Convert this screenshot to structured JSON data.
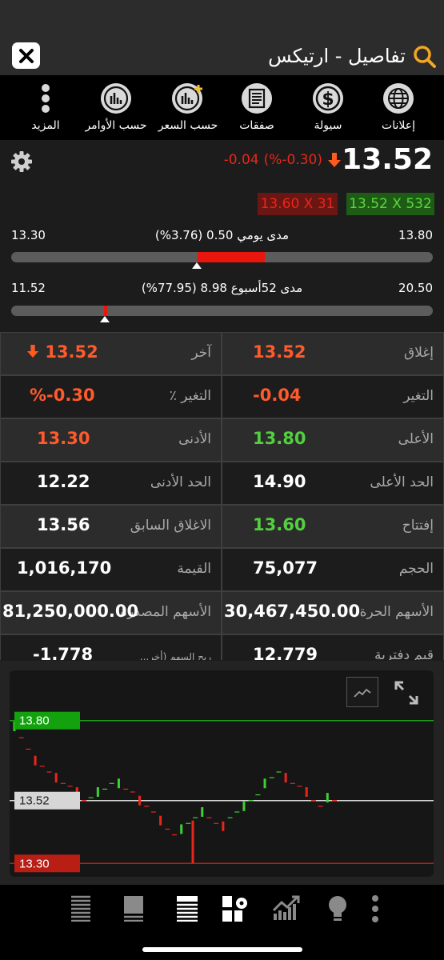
{
  "header": {
    "title": "تفاصيل - ارتيكس",
    "close_icon": "close-icon",
    "search_icon": "search-icon"
  },
  "toolbar": {
    "items": [
      {
        "label": "إعلانات",
        "icon": "globe-icon"
      },
      {
        "label": "سيولة",
        "icon": "dollar-icon"
      },
      {
        "label": "صفقات",
        "icon": "document-icon"
      },
      {
        "label": "حسب السعر",
        "icon": "bar-chart-plus-icon"
      },
      {
        "label": "حسب الأوامر",
        "icon": "bar-chart-icon"
      },
      {
        "label": "المزيد",
        "icon": "more-vertical-icon"
      }
    ]
  },
  "quote": {
    "price": "13.52",
    "change": "-0.04",
    "change_pct": "(%-0.30)",
    "ask": "13.60 X 31",
    "bid": "13.52 X 532",
    "colors": {
      "up": "#53cf3f",
      "down": "#e8261b"
    }
  },
  "day_range": {
    "low": "13.30",
    "high": "13.80",
    "label": "مدى يومي 0.50 (3.76%)",
    "position": 0.44
  },
  "week52_range": {
    "low": "11.52",
    "high": "20.50",
    "label": "مدى 52أسبوع 8.98 (77.95%)",
    "position": 0.22
  },
  "stats": {
    "rows": [
      {
        "right_label": "إغلاق",
        "right_value": "13.52",
        "left_label": "آخر",
        "left_value": "13.52"
      },
      {
        "right_label": "التغير",
        "right_value": "-0.04",
        "left_label": "التغير ٪",
        "left_value": "%-0.30"
      },
      {
        "right_label": "الأعلى",
        "right_value": "13.80",
        "left_label": "الأدنى",
        "left_value": "13.30"
      },
      {
        "right_label": "الحد الأعلى",
        "right_value": "14.90",
        "left_label": "الحد الأدنى",
        "left_value": "12.22"
      },
      {
        "right_label": "إفتتاح",
        "right_value": "13.60",
        "left_label": "الاغلاق السابق",
        "left_value": "13.56"
      },
      {
        "right_label": "الحجم",
        "right_value": "75,077",
        "left_label": "القيمة",
        "left_value": "1,016,170"
      },
      {
        "right_label": "الأسهم الحرة",
        "right_value": "30,467,450.00",
        "left_label": "الأسهم المصدرة",
        "left_value": "81,250,000.00"
      },
      {
        "right_label": "قيم دفترية",
        "right_value": "12.779",
        "left_label": "ربح السهم (أخر...",
        "left_value": "-1.778"
      }
    ]
  },
  "chart": {
    "high_label": "13.80",
    "last_label": "13.52",
    "low_label": "13.30",
    "icons": [
      "line-chart-icon",
      "expand-icon"
    ]
  },
  "chart_data": {
    "type": "line",
    "title": "",
    "xlabel": "",
    "ylabel": "",
    "ylim": [
      13.27,
      13.83
    ],
    "reference_lines": [
      {
        "name": "",
        "value": 13.8,
        "color": "#1f9c1a"
      },
      {
        "name": "",
        "value": 13.52,
        "color": "#d8d8d8"
      },
      {
        "name": "",
        "value": 13.3,
        "color": "#b91e14"
      }
    ],
    "series": [
      {
        "values": [
          13.78,
          13.74,
          13.7,
          13.66,
          13.64,
          13.62,
          13.6,
          13.58,
          13.57,
          13.55,
          13.52,
          13.53,
          13.55,
          13.56,
          13.58,
          13.58,
          13.56,
          13.55,
          13.52,
          13.5,
          13.48,
          13.45,
          13.42,
          13.4,
          13.42,
          13.44,
          13.46,
          13.48,
          13.46,
          13.44,
          13.43,
          13.46,
          13.48,
          13.5,
          13.52,
          13.54,
          13.58,
          13.6,
          13.62,
          13.6,
          13.58,
          13.57,
          13.55,
          13.52,
          13.5,
          13.53,
          13.52
        ]
      }
    ]
  },
  "bottom_nav": {
    "icons": [
      "order-book-icon",
      "list-icon",
      "table-icon",
      "grid-settings-icon",
      "trend-chart-icon",
      "lightbulb-icon",
      "more-vertical-icon"
    ]
  }
}
